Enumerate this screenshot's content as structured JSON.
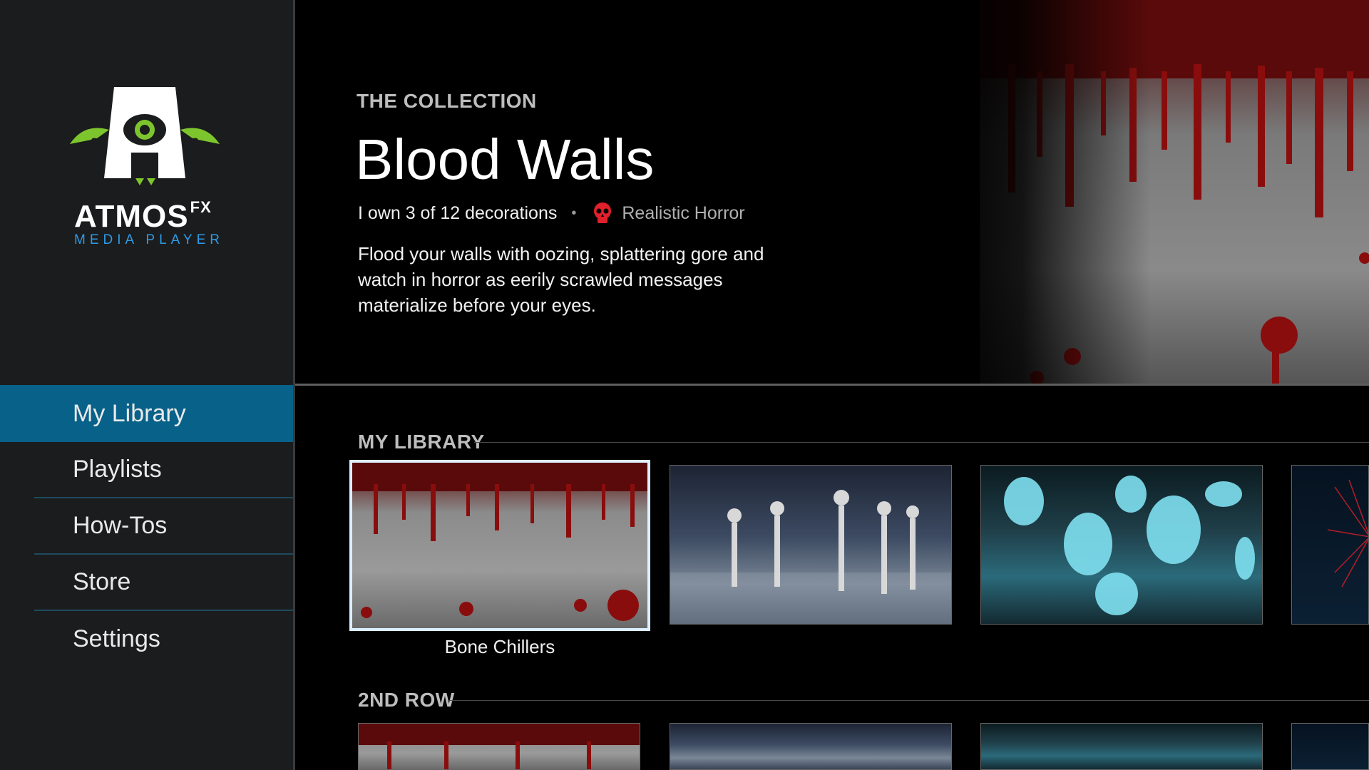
{
  "logo": {
    "name": "ATMOS",
    "suffix": "FX",
    "subtitle": "MEDIA PLAYER"
  },
  "nav": {
    "items": [
      {
        "label": "My Library",
        "active": true
      },
      {
        "label": "Playlists"
      },
      {
        "label": "How-Tos"
      },
      {
        "label": "Store"
      },
      {
        "label": "Settings"
      }
    ]
  },
  "hero": {
    "eyebrow": "THE COLLECTION",
    "title": "Blood Walls",
    "ownership": "I own 3 of 12 decorations",
    "genre": "Realistic Horror",
    "genre_icon": "skull-icon",
    "description": "Flood your walls with oozing, splattering gore and watch in horror as eerily scrawled messages materialize before your eyes."
  },
  "rows": [
    {
      "title": "MY LIBRARY",
      "focused_caption": "Bone Chillers"
    },
    {
      "title": "2ND ROW"
    }
  ],
  "colors": {
    "accent": "#076189",
    "logo_green": "#7dc52d",
    "subtitle_blue": "#2e9be6",
    "genre_red": "#e0202a"
  }
}
